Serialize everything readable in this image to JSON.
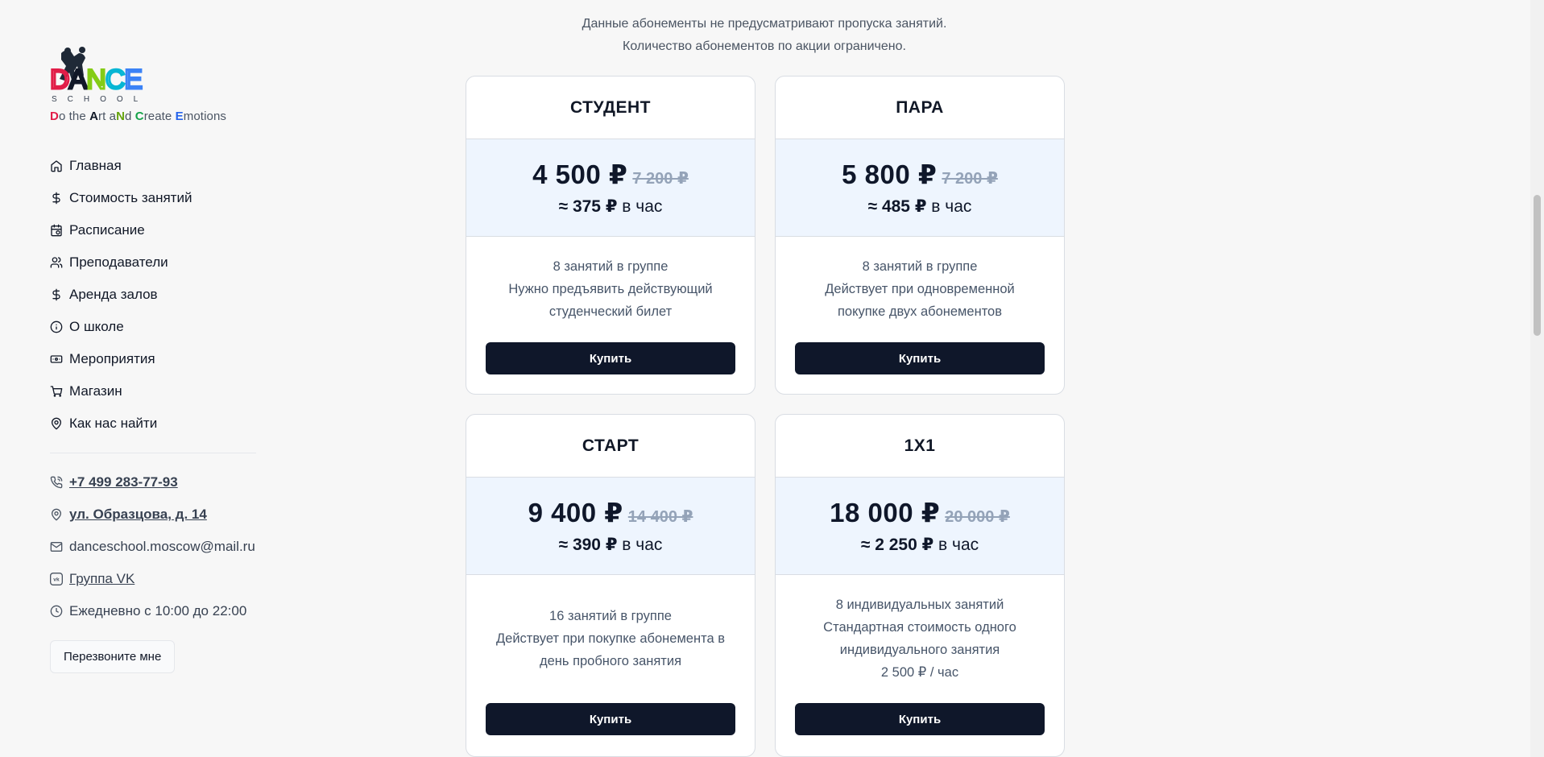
{
  "brand": {
    "logo_text": "DANCE",
    "logo_sub": "SCHOOL",
    "tagline": [
      {
        "t": "D",
        "c": "#e11d48"
      },
      {
        "t": "o the ",
        "c": "#4b5563"
      },
      {
        "t": "A",
        "c": "#111827"
      },
      {
        "t": "rt a",
        "c": "#4b5563"
      },
      {
        "t": "N",
        "c": "#65a30d"
      },
      {
        "t": "d ",
        "c": "#4b5563"
      },
      {
        "t": "C",
        "c": "#16a34a"
      },
      {
        "t": "reate ",
        "c": "#4b5563"
      },
      {
        "t": "E",
        "c": "#2563eb"
      },
      {
        "t": "motions",
        "c": "#4b5563"
      }
    ]
  },
  "nav": [
    {
      "label": "Главная",
      "icon": "home-icon"
    },
    {
      "label": "Стоимость занятий",
      "icon": "dollar-icon"
    },
    {
      "label": "Расписание",
      "icon": "calendar-clock-icon"
    },
    {
      "label": "Преподаватели",
      "icon": "users-icon"
    },
    {
      "label": "Аренда залов",
      "icon": "dollar-icon"
    },
    {
      "label": "О школе",
      "icon": "info-icon"
    },
    {
      "label": "Мероприятия",
      "icon": "ticket-icon"
    },
    {
      "label": "Магазин",
      "icon": "cart-icon"
    },
    {
      "label": "Как нас найти",
      "icon": "map-pin-icon"
    }
  ],
  "contacts": {
    "phone": "+7 499 283-77-93",
    "address": "ул. Образцова, д. 14",
    "email": "danceschool.moscow@mail.ru",
    "vk": "Группа VK",
    "hours": "Ежедневно с 10:00 до 22:00"
  },
  "callback_label": "Перезвоните мне",
  "notice": [
    "Данные абонементы не предусматривают пропуска занятий.",
    "Количество абонементов по акции ограничено."
  ],
  "cards": [
    {
      "title": "СТУДЕНТ",
      "price": "4 500 ₽",
      "old_price": "7 200 ₽",
      "per_hour": "375 ₽",
      "approx": "≈",
      "per_hour_suffix": "в час",
      "lines": [
        "8 занятий в группе",
        "Нужно предъявить действующий",
        "студенческий билет"
      ],
      "buy": "Купить"
    },
    {
      "title": "ПАРА",
      "price": "5 800 ₽",
      "old_price": "7 200 ₽",
      "per_hour": "485 ₽",
      "approx": "≈",
      "per_hour_suffix": "в час",
      "lines": [
        "8 занятий в группе",
        "Действует при одновременной",
        "покупке двух абонементов"
      ],
      "buy": "Купить"
    },
    {
      "title": "СТАРТ",
      "price": "9 400 ₽",
      "old_price": "14 400 ₽",
      "per_hour": "390 ₽",
      "approx": "≈",
      "per_hour_suffix": "в час",
      "lines": [
        "16 занятий в группе",
        "Действует при покупке абонемента в",
        "день пробного занятия"
      ],
      "buy": "Купить"
    },
    {
      "title": "1X1",
      "price": "18 000 ₽",
      "old_price": "20 000 ₽",
      "per_hour": "2 250 ₽",
      "approx": "≈",
      "per_hour_suffix": "в час",
      "lines": [
        "8 индивидуальных занятий",
        "Стандартная стоимость одного",
        "индивидуального занятия",
        "2 500 ₽ / час"
      ],
      "buy": "Купить"
    }
  ]
}
